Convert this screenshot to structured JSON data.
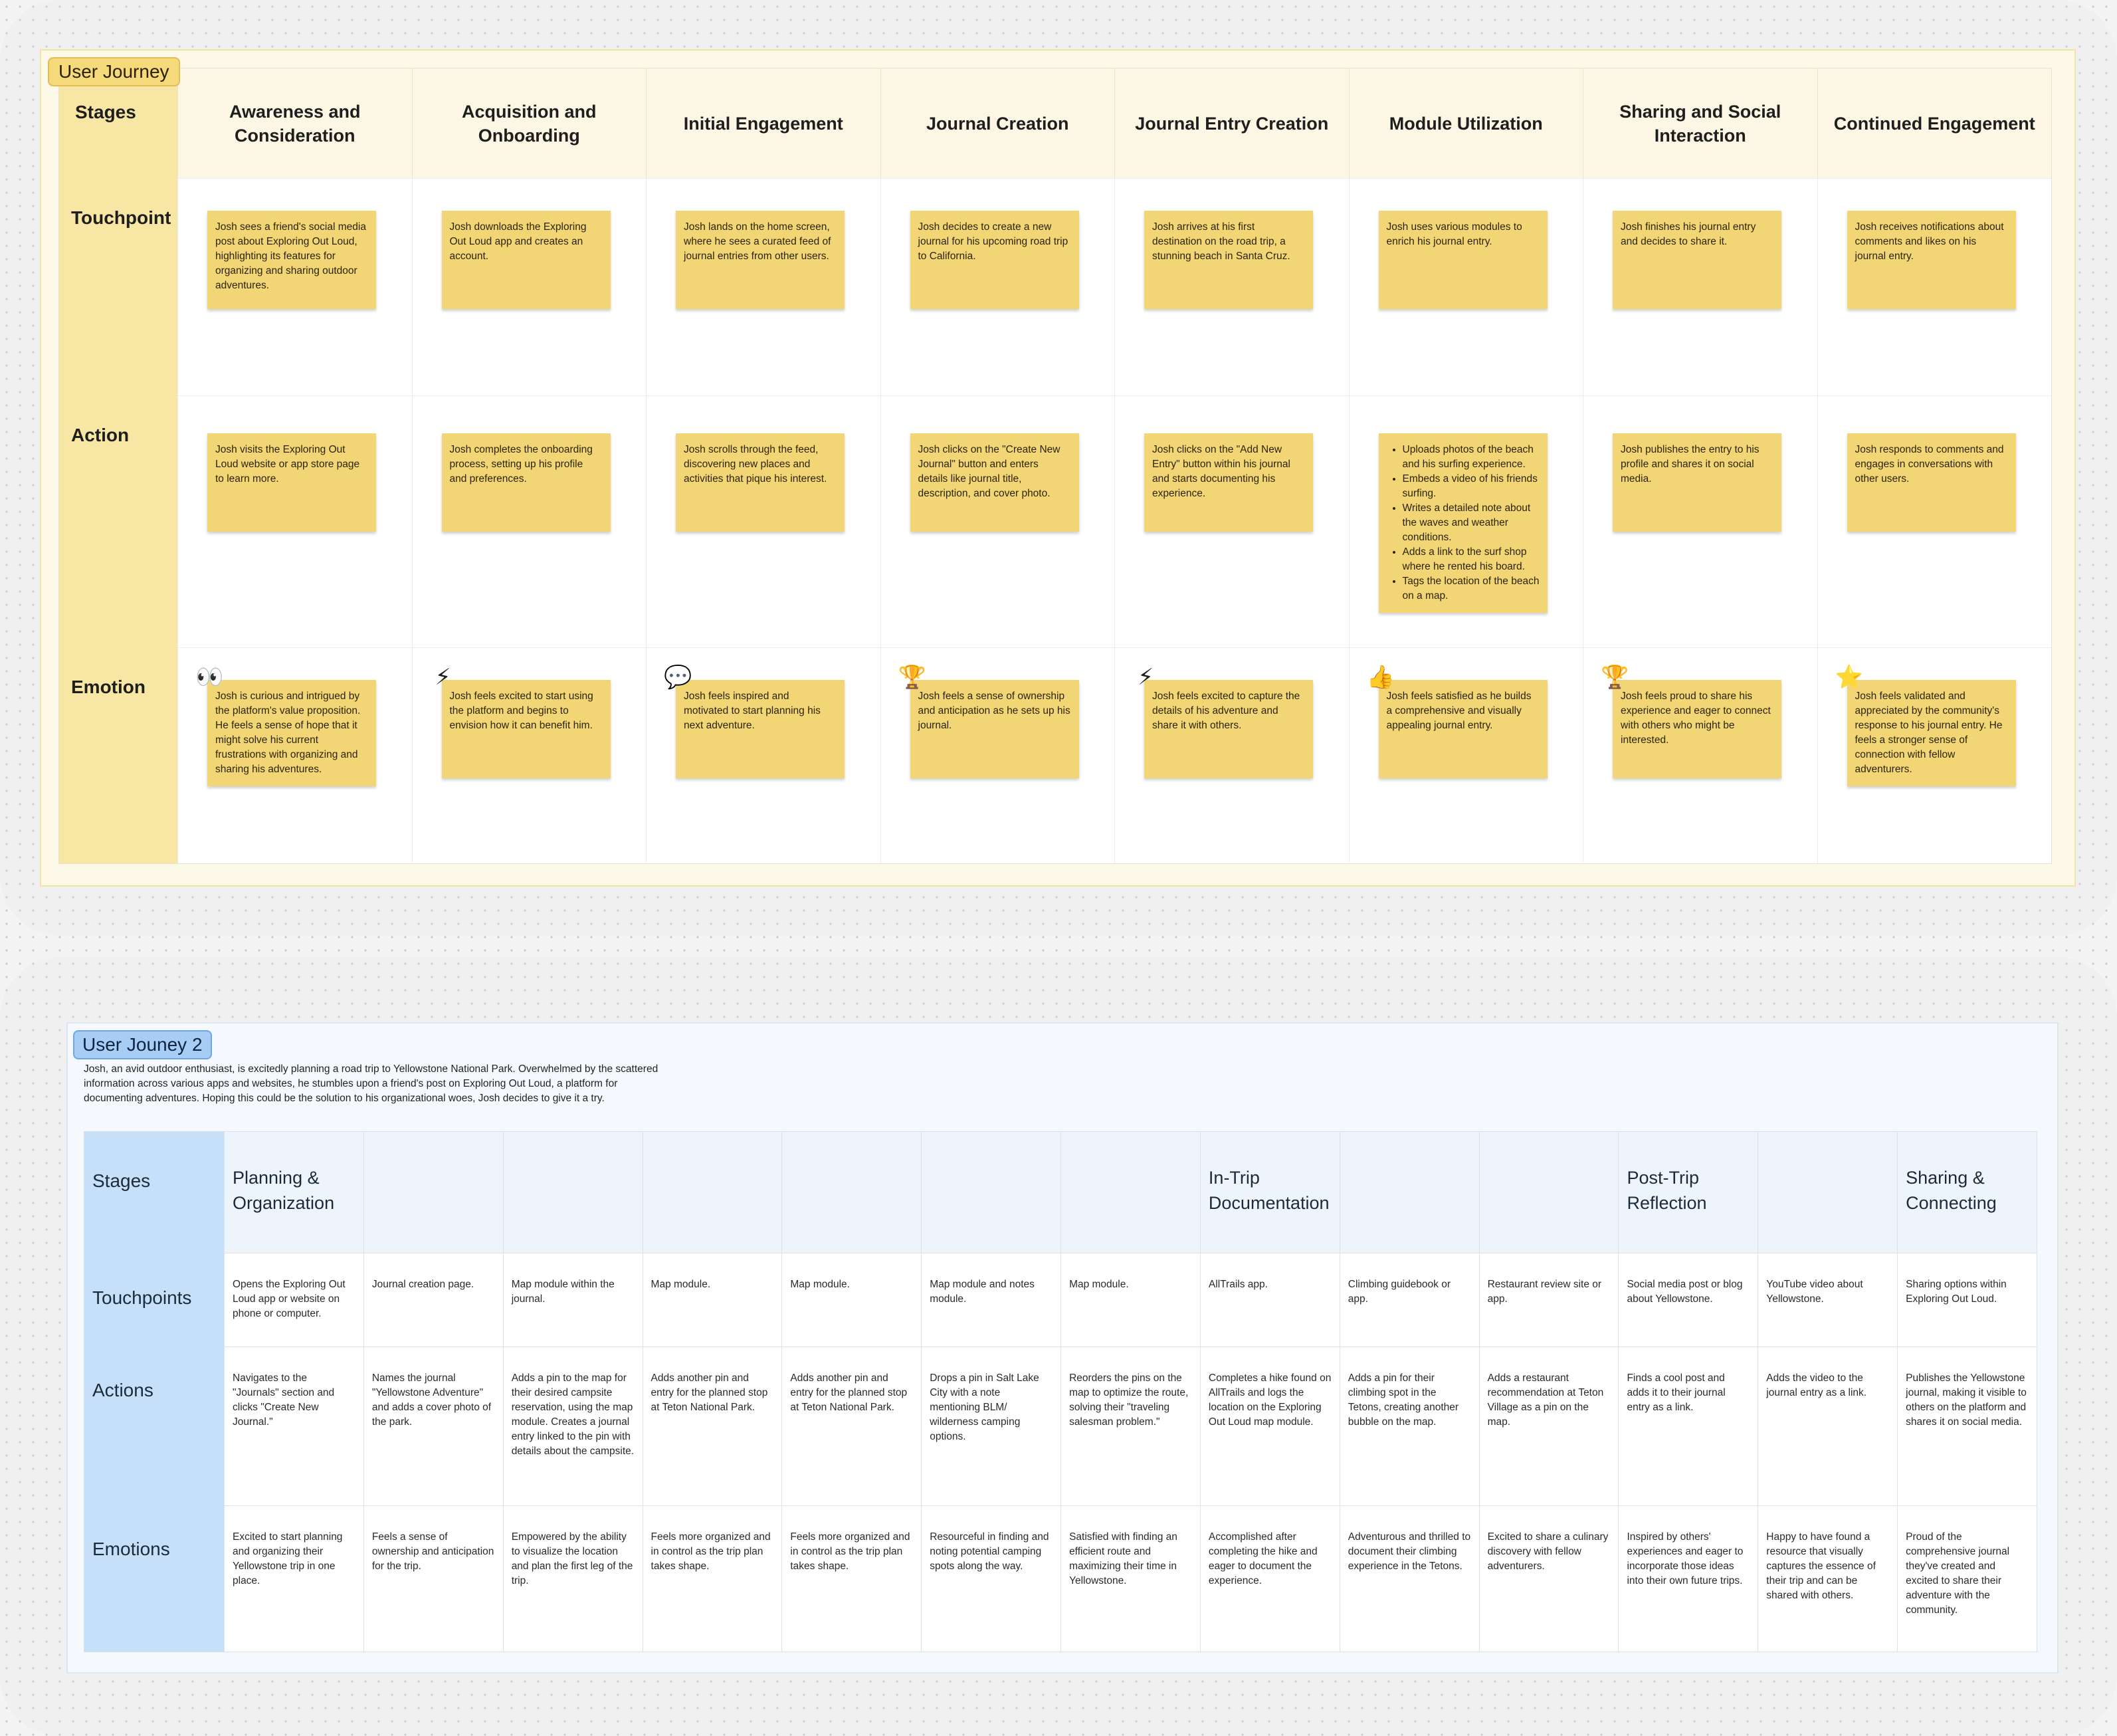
{
  "journey1": {
    "title": "User Journey",
    "row_labels": {
      "stages": "Stages",
      "touchpoint": "Touchpoint",
      "action": "Action",
      "emotion": "Emotion"
    },
    "stages": [
      "Awareness and Consideration",
      "Acquisition and Onboarding",
      "Initial Engagement",
      "Journal Creation",
      "Journal Entry Creation",
      "Module Utilization",
      "Sharing and Social Interaction",
      "Continued Engagement"
    ],
    "touchpoints": [
      "Josh sees a friend's social media post about Exploring Out Loud, highlighting its features for organizing and sharing outdoor adventures.",
      "Josh downloads the Exploring Out Loud app and creates an account.",
      "Josh lands on the home screen, where he sees a curated feed of journal entries from other users.",
      "Josh decides to create a new journal for his upcoming road trip to California.",
      "Josh arrives at his first destination on the road trip, a stunning beach in Santa Cruz.",
      "Josh uses various modules to enrich his journal entry.",
      "Josh finishes his journal entry and decides to share it.",
      "Josh receives notifications about comments and likes on his journal entry."
    ],
    "actions": [
      "Josh visits the Exploring Out Loud website or app store page to learn more.",
      "Josh completes the onboarding process, setting up his profile and preferences.",
      "Josh scrolls through the feed, discovering new places and activities that pique his interest.",
      "Josh clicks on the \"Create New Journal\" button and enters details like journal title, description, and cover photo.",
      "Josh clicks on the \"Add New Entry\" button within his journal and starts documenting his experience.",
      "",
      "Josh publishes the entry to his profile and shares it on social media.",
      "Josh responds to comments and engages in conversations with other users."
    ],
    "module_action_bullets": [
      "Uploads photos of the beach and his surfing experience.",
      "Embeds a video of his friends surfing.",
      "Writes a detailed note about the waves and weather conditions.",
      "Adds a link to the surf shop where he rented his board.",
      "Tags the location of the beach on a map."
    ],
    "emotions": [
      "Josh is curious and intrigued by the platform's value proposition. He feels a sense of hope that it might solve his current frustrations with organizing and sharing his adventures.",
      "Josh feels excited to start using the platform and begins to envision how it can benefit him.",
      "Josh feels inspired and motivated to start planning his next adventure.",
      "Josh feels a sense of ownership and anticipation as he sets up his journal.",
      "Josh feels excited to capture the details of his adventure and share it with others.",
      "Josh feels satisfied as he builds a comprehensive and visually appealing journal entry.",
      "Josh feels proud to share his experience and eager to connect with others who might be interested.",
      "Josh feels validated and appreciated by the community's response to his journal entry. He feels a stronger sense of connection with fellow adventurers."
    ],
    "emotion_icons": [
      "eyes-icon",
      "lightning-icon",
      "speech-bubble-icon",
      "trophy-icon",
      "lightning-icon",
      "thumbs-up-icon",
      "trophy-icon",
      "star-icon"
    ]
  },
  "journey2": {
    "title": "User Jouney 2",
    "description": "Josh, an avid outdoor enthusiast, is excitedly planning a road trip to Yellowstone National Park. Overwhelmed by the scattered information across various apps and websites, he stumbles upon a friend's post on Exploring Out Loud, a platform for documenting adventures. Hoping this could be the solution to his organizational woes, Josh decides to give it a try.",
    "row_labels": {
      "stages": "Stages",
      "touchpoints": "Touchpoints",
      "actions": "Actions",
      "emotions": "Emotions"
    },
    "stages": [
      "Planning & Organization",
      "",
      "",
      "",
      "",
      "",
      "",
      "In-Trip Documentation",
      "",
      "",
      "Post-Trip Reflection",
      "",
      "Sharing & Connecting"
    ],
    "touchpoints": [
      "Opens the Exploring Out Loud app or website on phone or computer.",
      "Journal creation page.",
      "Map module within the journal.",
      "Map module.",
      "Map module.",
      "Map module and notes module.",
      "Map module.",
      "AllTrails app.",
      "Climbing guidebook or app.",
      "Restaurant review site or app.",
      "Social media post or blog about Yellowstone.",
      "YouTube video about Yellowstone.",
      "Sharing options within Exploring Out Loud."
    ],
    "actions": [
      "Navigates to the \"Journals\" section and clicks \"Create New Journal.\"",
      "Names the journal \"Yellowstone Adventure\" and adds a cover photo of the park.",
      "Adds a pin to the map for their desired campsite reservation, using the map module. Creates a journal entry linked to the pin with details about the campsite.",
      "Adds another pin and entry for the planned stop at Teton National Park.",
      "Adds another pin and entry for the planned stop at Teton National Park.",
      "Drops a pin in Salt Lake City with a note mentioning BLM/ wilderness camping options.",
      "Reorders the pins on the map to optimize the route, solving their \"traveling salesman problem.\"",
      "Completes a hike found on AllTrails and logs the location on the Exploring Out Loud map module.",
      "Adds a pin for their climbing spot in the Tetons, creating another bubble on the map.",
      "Adds a restaurant recommendation at Teton Village as a pin on the map.",
      "Finds a cool post and adds it to their journal entry as a link.",
      "Adds the video to the journal entry as a link.",
      "Publishes the Yellowstone journal, making it visible to others on the platform and shares it on social media."
    ],
    "emotions": [
      "Excited to start planning and organizing their Yellowstone trip in one place.",
      "Feels a sense of ownership and anticipation for the trip.",
      "Empowered by the ability to visualize the location and plan the first leg of the trip.",
      "Feels more organized and in control as the trip plan takes shape.",
      "Feels more organized and in control as the trip plan takes shape.",
      "Resourceful in finding and noting potential camping spots along the way.",
      "Satisfied with finding an efficient route and maximizing their time in Yellowstone.",
      "Accomplished after completing the hike and eager to document the experience.",
      "Adventurous and thrilled to document their climbing experience in the Tetons.",
      "Excited to share a culinary discovery with fellow adventurers.",
      "Inspired by others' experiences and eager to incorporate those ideas into their own future trips.",
      "Happy to have found a resource that visually captures the essence of their trip and can be shared with others.",
      "Proud of the comprehensive journal they've created and excited to share their adventure with the community."
    ]
  }
}
